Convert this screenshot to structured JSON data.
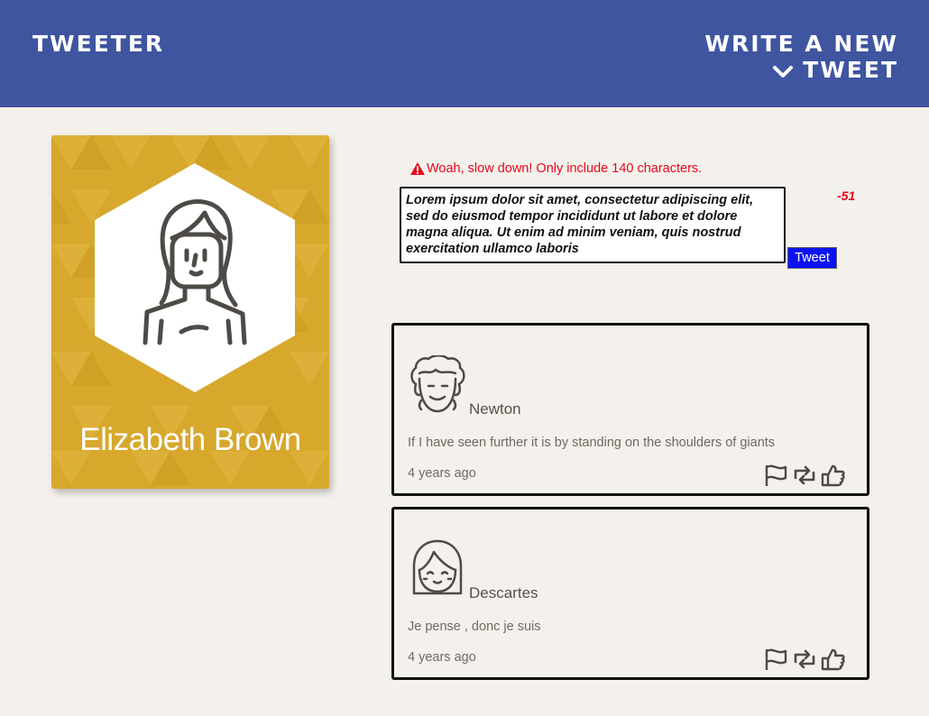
{
  "nav": {
    "brand": "Tweeter",
    "compose_label": "Write a new tweet",
    "compose_icon": "chevron-down-icon"
  },
  "profile": {
    "name": "Elizabeth Brown",
    "card_color": "#d7a82c"
  },
  "compose": {
    "error": "Woah, slow down! Only include 140 characters.",
    "text": "Lorem ipsum dolor sit amet, consectetur adipiscing elit, sed do eiusmod tempor incididunt ut labore et dolore magna aliqua. Ut enim ad minim veniam, quis nostrud exercitation ullamco laboris",
    "counter": "-51",
    "button_label": "Tweet"
  },
  "tweets": [
    {
      "author": "Newton",
      "content": "If I have seen further it is by standing on the shoulders of giants",
      "time": "4 years ago",
      "avatar_icon": "curly-hair-avatar-icon"
    },
    {
      "author": "Descartes",
      "content": "Je pense , donc je suis",
      "time": "4 years ago",
      "avatar_icon": "bob-hair-avatar-icon"
    }
  ],
  "actions": [
    "flag-icon",
    "retweet-icon",
    "like-icon"
  ],
  "colors": {
    "navbar": "#3f55a0",
    "background": "#f4f1ec",
    "error": "#e8071b",
    "button": "#0a14f2"
  }
}
